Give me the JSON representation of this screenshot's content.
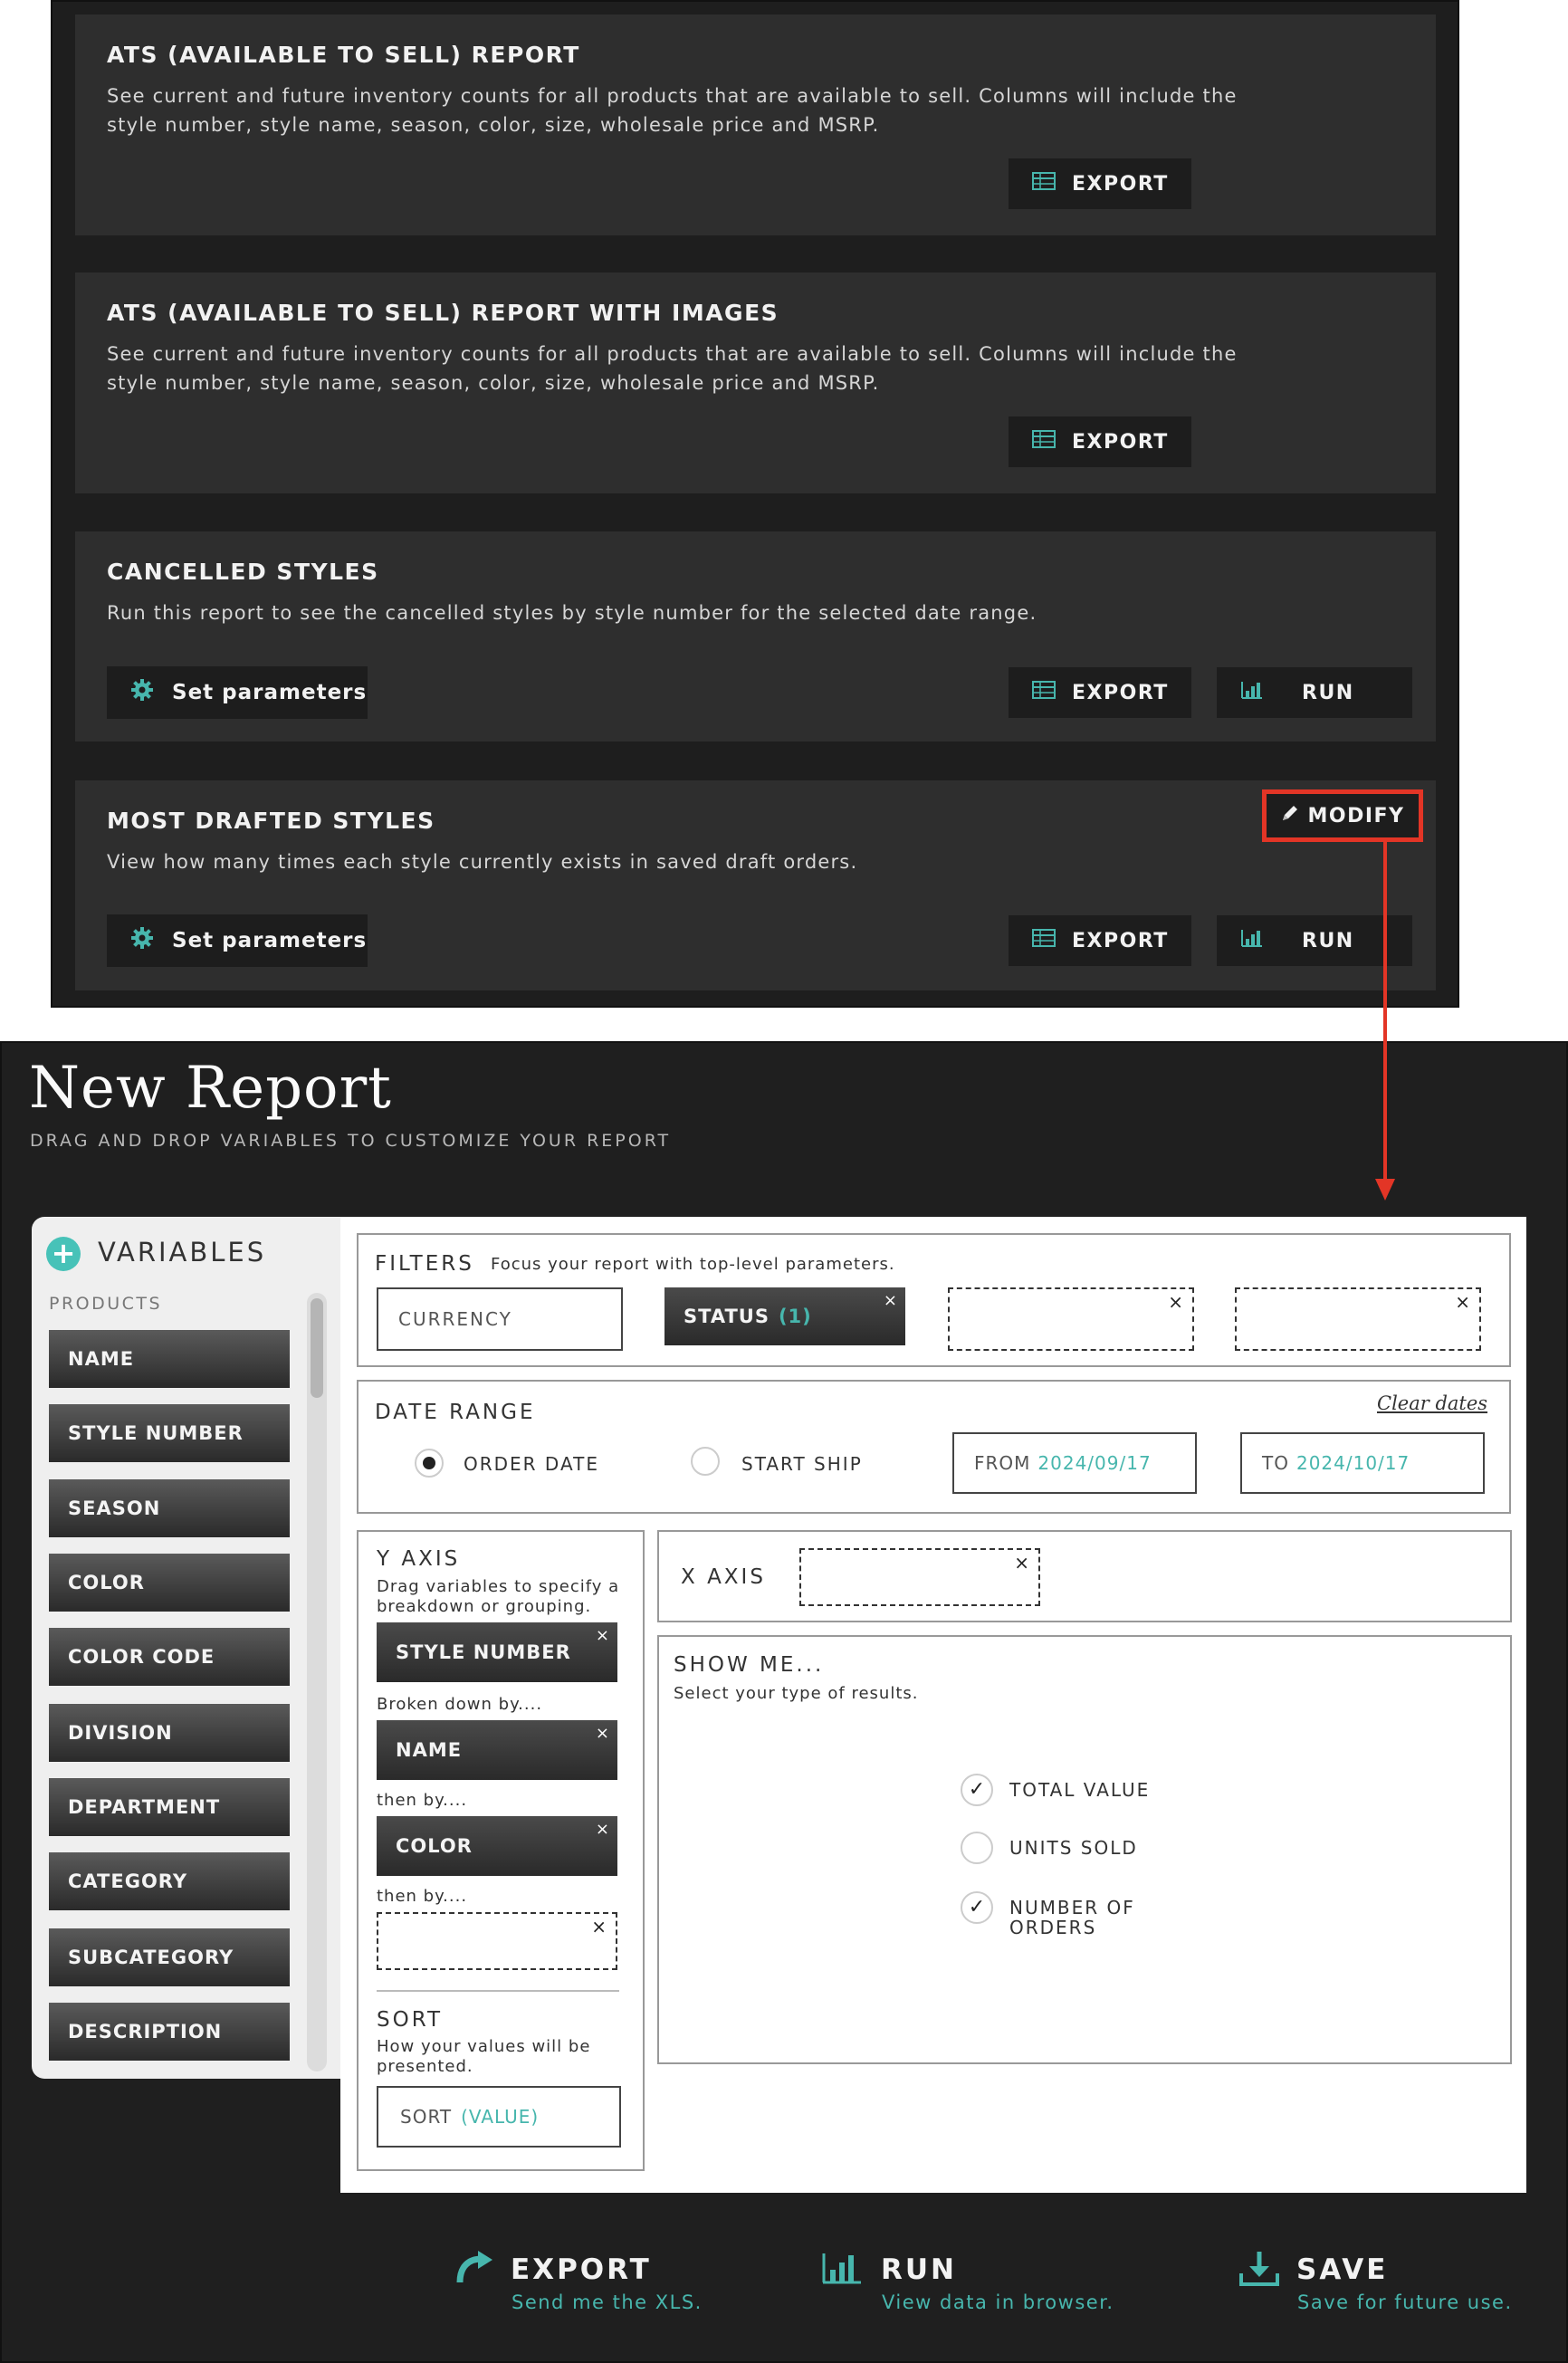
{
  "colors": {
    "accent_teal": "#47b6ad",
    "highlight_red": "#e33526",
    "panel_dark": "#1f1f1f",
    "card_bg": "#2e2e2e"
  },
  "reports": [
    {
      "title": "ATS (AVAILABLE TO SELL) REPORT",
      "description": "See current and future inventory counts for all products that are available to sell. Columns will include the style number, style name, season, color, size, wholesale price and MSRP.",
      "export_label": "EXPORT"
    },
    {
      "title": "ATS (AVAILABLE TO SELL) REPORT WITH IMAGES",
      "description": "See current and future inventory counts for all products that are available to sell. Columns will include the style number, style name, season, color, size, wholesale price and MSRP.",
      "export_label": "EXPORT"
    },
    {
      "title": "CANCELLED STYLES",
      "description": "Run this report to see the cancelled styles by style number for the selected date range.",
      "params_label": "Set parameters",
      "export_label": "EXPORT",
      "run_label": "RUN"
    },
    {
      "title": "MOST DRAFTED STYLES",
      "description": "View how many times each style currently exists in saved draft orders.",
      "params_label": "Set parameters",
      "export_label": "EXPORT",
      "run_label": "RUN",
      "modify_label": "MODIFY"
    }
  ],
  "new_report": {
    "title": "New Report",
    "subtitle": "DRAG AND DROP VARIABLES TO CUSTOMIZE YOUR REPORT",
    "variables": {
      "title": "VARIABLES",
      "group": "PRODUCTS",
      "items": [
        "NAME",
        "STYLE NUMBER",
        "SEASON",
        "COLOR",
        "COLOR CODE",
        "DIVISION",
        "DEPARTMENT",
        "CATEGORY",
        "SUBCATEGORY",
        "DESCRIPTION"
      ]
    },
    "filters": {
      "label": "FILTERS",
      "hint": "Focus your report with top-level parameters.",
      "currency": "CURRENCY",
      "status": "STATUS",
      "status_count": "(1)"
    },
    "date_range": {
      "label": "DATE RANGE",
      "clear": "Clear dates",
      "option_order": "ORDER DATE",
      "option_ship": "START SHIP",
      "selected": "ORDER DATE",
      "from_label": "FROM",
      "from_value": "2024/09/17",
      "to_label": "TO",
      "to_value": "2024/10/17"
    },
    "y_axis": {
      "label": "Y AXIS",
      "hint": "Drag variables to specify a breakdown or grouping.",
      "first": "STYLE NUMBER",
      "broken_by": "Broken down by....",
      "second": "NAME",
      "then_by_1": "then by....",
      "third": "COLOR",
      "then_by_2": "then by...."
    },
    "sort": {
      "label": "SORT",
      "hint": "How your values will be presented.",
      "field_label": "SORT",
      "field_value": "(VALUE)"
    },
    "x_axis": {
      "label": "X AXIS"
    },
    "show_me": {
      "label": "SHOW ME...",
      "hint": "Select your type of results.",
      "options": [
        {
          "label": "TOTAL VALUE",
          "checked": true
        },
        {
          "label": "UNITS SOLD",
          "checked": false
        },
        {
          "label": "NUMBER OF ORDERS",
          "checked": true
        }
      ]
    },
    "actions": {
      "export": {
        "label": "EXPORT",
        "hint": "Send me the XLS."
      },
      "run": {
        "label": "RUN",
        "hint": "View data in browser."
      },
      "save": {
        "label": "SAVE",
        "hint": "Save for future use."
      }
    }
  }
}
